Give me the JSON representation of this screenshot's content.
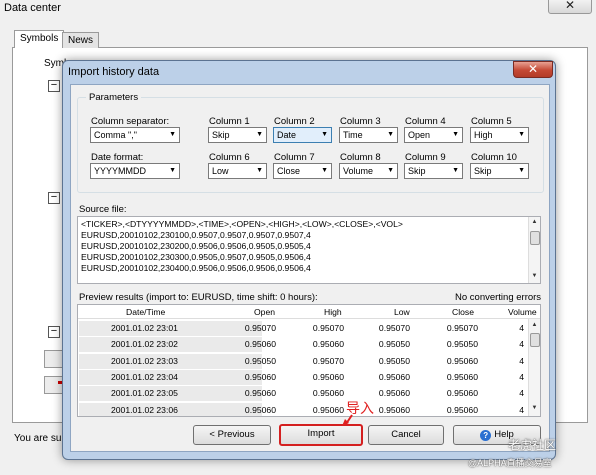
{
  "background": {
    "title": "Data center",
    "close_glyph": "✕",
    "tabs": [
      "Symbols",
      "News"
    ],
    "symbols_label": "Symbo",
    "footer_text": "You are sub"
  },
  "dialog": {
    "title": "Import history data",
    "close_glyph": "✕"
  },
  "parameters": {
    "legend": "Parameters",
    "column_separator_label": "Column separator:",
    "column_separator_value": "Comma \",\"",
    "date_format_label": "Date format:",
    "date_format_value": "YYYYMMDD",
    "columns": [
      {
        "label": "Column 1",
        "value": "Skip",
        "highlighted": false
      },
      {
        "label": "Column 2",
        "value": "Date",
        "highlighted": true
      },
      {
        "label": "Column 3",
        "value": "Time",
        "highlighted": false
      },
      {
        "label": "Column 4",
        "value": "Open",
        "highlighted": false
      },
      {
        "label": "Column 5",
        "value": "High",
        "highlighted": false
      },
      {
        "label": "Column 6",
        "value": "Low",
        "highlighted": false
      },
      {
        "label": "Column 7",
        "value": "Close",
        "highlighted": false
      },
      {
        "label": "Column 8",
        "value": "Volume",
        "highlighted": false
      },
      {
        "label": "Column 9",
        "value": "Skip",
        "highlighted": false
      },
      {
        "label": "Column 10",
        "value": "Skip",
        "highlighted": false
      }
    ]
  },
  "source": {
    "label": "Source file:",
    "lines": [
      "<TICKER>,<DTYYYYMMDD>,<TIME>,<OPEN>,<HIGH>,<LOW>,<CLOSE>,<VOL>",
      "EURUSD,20010102,230100,0.9507,0.9507,0.9507,0.9507,4",
      "EURUSD,20010102,230200,0.9506,0.9506,0.9505,0.9505,4",
      "EURUSD,20010102,230300,0.9505,0.9507,0.9505,0.9506,4",
      "EURUSD,20010102,230400,0.9506,0.9506,0.9506,0.9506,4"
    ]
  },
  "preview": {
    "label": "Preview results (import to: EURUSD, time shift: 0 hours):",
    "status": "No converting errors",
    "columns": [
      "Date/Time",
      "Open",
      "High",
      "Low",
      "Close",
      "Volume"
    ],
    "rows": [
      [
        "2001.01.02 23:01",
        "0.95070",
        "0.95070",
        "0.95070",
        "0.95070",
        "4"
      ],
      [
        "2001.01.02 23:02",
        "0.95060",
        "0.95060",
        "0.95050",
        "0.95050",
        "4"
      ],
      [
        "2001.01.02 23:03",
        "0.95050",
        "0.95070",
        "0.95050",
        "0.95060",
        "4"
      ],
      [
        "2001.01.02 23:04",
        "0.95060",
        "0.95060",
        "0.95060",
        "0.95060",
        "4"
      ],
      [
        "2001.01.02 23:05",
        "0.95060",
        "0.95060",
        "0.95060",
        "0.95060",
        "4"
      ],
      [
        "2001.01.02 23:06",
        "0.95060",
        "0.95060",
        "0.95060",
        "0.95060",
        "4"
      ]
    ]
  },
  "buttons": {
    "previous": "< Previous",
    "import": "Import",
    "cancel": "Cancel",
    "help": "Help"
  },
  "annotation": {
    "text": "导入",
    "color": "#e02020"
  },
  "watermark": {
    "line1": "老虎社区",
    "line2": "@ALPHA直播交易室"
  },
  "colors": {
    "dialog_frame": "#bcd0e8",
    "close_button": "#c44834",
    "highlight_select": "#e1eefb"
  }
}
